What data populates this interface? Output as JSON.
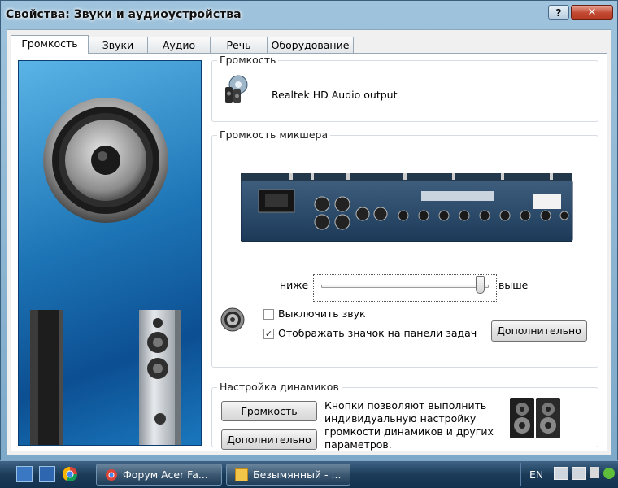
{
  "window": {
    "title": "Свойства: Звуки и аудиоустройства",
    "help_label": "?",
    "close_label": "✕"
  },
  "tabs": [
    {
      "label": "Громкость",
      "active": true
    },
    {
      "label": "Звуки"
    },
    {
      "label": "Аудио"
    },
    {
      "label": "Речь"
    },
    {
      "label": "Оборудование"
    }
  ],
  "volume_group": {
    "title": "Громкость",
    "device_name": "Realtek HD Audio output"
  },
  "mixer_group": {
    "title": "Громкость микшера",
    "low_label": "ниже",
    "high_label": "выше",
    "slider_level_fraction": 0.95,
    "mute_label": "Выключить звук",
    "mute_checked": false,
    "show_icon_label": "Отображать значок на панели задач",
    "show_icon_checked": true,
    "advanced_button": "Дополнительно"
  },
  "speaker_group": {
    "title": "Настройка динамиков",
    "volume_button": "Громкость",
    "advanced_button": "Дополнительно",
    "description": "Кнопки позволяют выполнить индивидуальную настройку громкости динамиков и других параметров."
  },
  "taskbar": {
    "tasks": [
      {
        "label": "Форум Acer Fa..."
      },
      {
        "label": "Безымянный - ..."
      }
    ],
    "language": "EN"
  }
}
